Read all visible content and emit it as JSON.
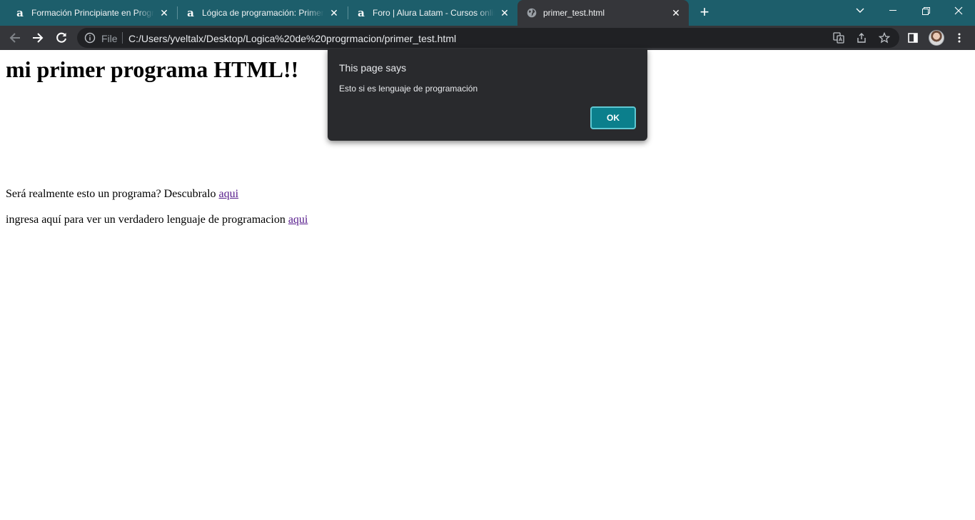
{
  "browser": {
    "tabs": [
      {
        "title": "Formación Principiante en Programación",
        "favicon": "alura-icon"
      },
      {
        "title": "Lógica de programación: Primeros pasos",
        "favicon": "alura-icon"
      },
      {
        "title": "Foro | Alura Latam - Cursos online de tecnología",
        "favicon": "alura-icon"
      },
      {
        "title": "primer_test.html",
        "favicon": "globe-icon"
      }
    ],
    "active_tab": 3,
    "address_bar": {
      "scheme_label": "File",
      "url": "C:/Users/yveltalx/Desktop/Logica%20de%20progrmacion/primer_test.html"
    },
    "colors": {
      "tabstrip": "#1d5e6b",
      "toolbar": "#35363a",
      "accent": "#0b7f8c"
    }
  },
  "page": {
    "heading": "mi primer programa HTML!!",
    "lines": [
      {
        "text": "Será realmente esto un programa? Descubralo ",
        "link": "aqui"
      },
      {
        "text": "ingresa aquí para ver un verdadero lenguaje de programacion ",
        "link": "aqui"
      }
    ]
  },
  "dialog": {
    "title": "This page says",
    "message": "Esto si es lenguaje de programación",
    "ok_label": "OK"
  }
}
